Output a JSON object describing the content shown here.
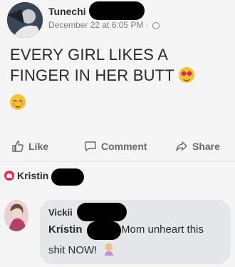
{
  "post": {
    "author": "Tunechi",
    "timestamp": "December 22 at 6:05 PM ·",
    "text_line1": "EVERY GIRL LIKES A",
    "text_line2": "FINGER IN HER BUTT",
    "emoji_1": "heart-eyes-emoji",
    "emoji_2": "smiling-blush-emoji"
  },
  "actions": {
    "like": "Like",
    "comment": "Comment",
    "share": "Share"
  },
  "reaction": {
    "name": "Kristin"
  },
  "comment": {
    "author": "Vickii",
    "tagged": "Kristin",
    "text_part1": "Mom unheart this",
    "text_part2": "shit NOW!"
  },
  "colors": {
    "background": "#f5f5f5",
    "accent_heart": "#f0284a",
    "muted": "#65676b",
    "bubble": "#e4e6ea"
  }
}
